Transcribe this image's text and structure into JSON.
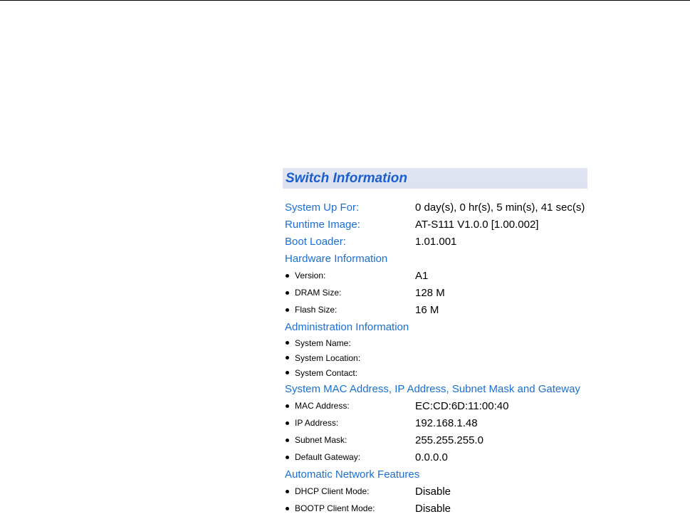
{
  "header": {
    "title": "Switch Information"
  },
  "summary": [
    {
      "label": "System Up For:",
      "value": "0 day(s), 0 hr(s), 5 min(s), 41 sec(s)"
    },
    {
      "label": "Runtime Image:",
      "value": "AT-S111 V1.0.0 [1.00.002]"
    },
    {
      "label": "Boot Loader:",
      "value": "1.01.001"
    }
  ],
  "hardware": {
    "heading": "Hardware Information",
    "items": [
      {
        "label": "Version:",
        "value": "A1"
      },
      {
        "label": "DRAM Size:",
        "value": "128 M"
      },
      {
        "label": "Flash Size:",
        "value": "16 M"
      }
    ]
  },
  "administration": {
    "heading": "Administration Information",
    "items": [
      {
        "label": "System Name:",
        "value": ""
      },
      {
        "label": "System Location:",
        "value": ""
      },
      {
        "label": "System Contact:",
        "value": ""
      }
    ]
  },
  "network": {
    "heading": "System MAC Address, IP Address, Subnet Mask and Gateway",
    "items": [
      {
        "label": "MAC Address:",
        "value": "EC:CD:6D:11:00:40"
      },
      {
        "label": "IP Address:",
        "value": "192.168.1.48"
      },
      {
        "label": "Subnet Mask:",
        "value": "255.255.255.0"
      },
      {
        "label": "Default Gateway:",
        "value": "0.0.0.0"
      }
    ]
  },
  "features": {
    "heading": "Automatic Network Features",
    "items": [
      {
        "label": "DHCP Client Mode:",
        "value": "Disable"
      },
      {
        "label": "BOOTP Client Mode:",
        "value": "Disable"
      }
    ]
  },
  "colors": {
    "accent_text": "#1a6fd6",
    "title_text": "#1a5fd0",
    "title_bar_bg": "#e0e4f1"
  }
}
